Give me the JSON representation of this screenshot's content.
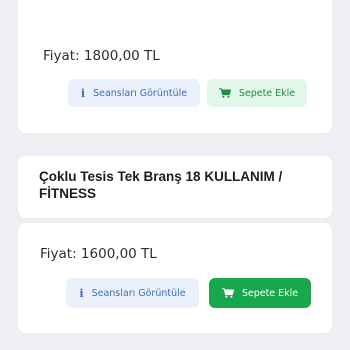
{
  "card1": {
    "price": "Fiyat: 1800,00 TL",
    "sessions_button": "Seansları Görüntüle",
    "cart_button": "Sepete Ekle"
  },
  "card2": {
    "title": "Çoklu Tesis Tek Branş 18 KULLANIM / FİTNESS",
    "price": "Fiyat: 1600,00 TL",
    "sessions_button": "Seansları Görüntüle",
    "cart_button": "Sepete Ekle"
  },
  "icons": {
    "info": "info-icon",
    "cart": "cart-icon"
  },
  "colors": {
    "background": "#eeeff2",
    "card": "#ffffff",
    "info_bg": "#eaf1fb",
    "info_text": "#3b6fb6",
    "cart_light_bg": "#e3f6ea",
    "cart_solid_bg": "#17a84c"
  }
}
